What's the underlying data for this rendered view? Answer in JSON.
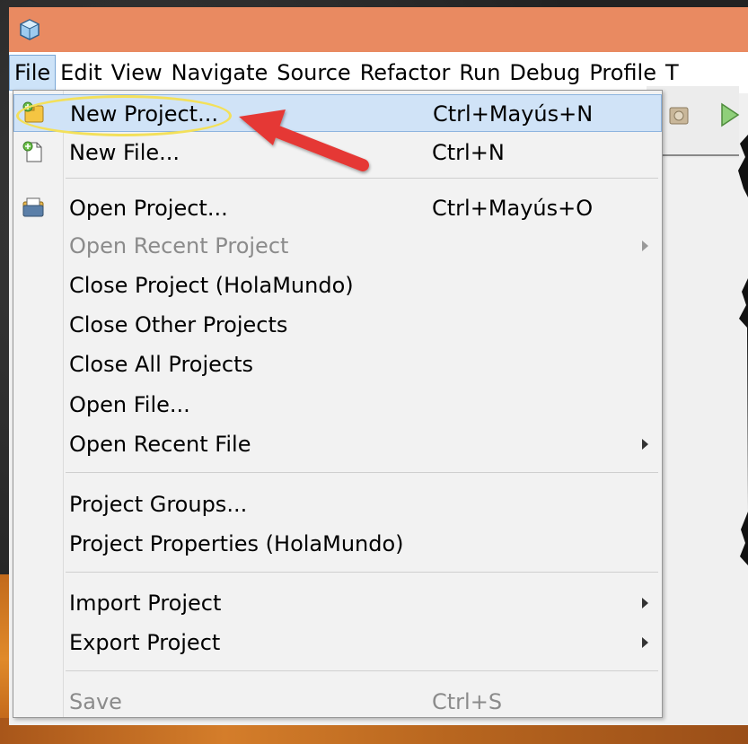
{
  "menubar": {
    "items": [
      {
        "label": "File",
        "active": true
      },
      {
        "label": "Edit"
      },
      {
        "label": "View"
      },
      {
        "label": "Navigate"
      },
      {
        "label": "Source"
      },
      {
        "label": "Refactor"
      },
      {
        "label": "Run"
      },
      {
        "label": "Debug"
      },
      {
        "label": "Profile"
      },
      {
        "label": "T"
      }
    ]
  },
  "file_menu": {
    "new_project": {
      "label": "New Project...",
      "shortcut": "Ctrl+Mayús+N",
      "icon": "new-project-icon"
    },
    "new_file": {
      "label": "New File...",
      "shortcut": "Ctrl+N",
      "icon": "new-file-icon"
    },
    "open_project": {
      "label": "Open Project...",
      "shortcut": "Ctrl+Mayús+O",
      "icon": "open-project-icon"
    },
    "open_recent_project": {
      "label": "Open Recent Project"
    },
    "close_project": {
      "label": "Close Project (HolaMundo)"
    },
    "close_other_projects": {
      "label": "Close Other Projects"
    },
    "close_all_projects": {
      "label": "Close All Projects"
    },
    "open_file": {
      "label": "Open File..."
    },
    "open_recent_file": {
      "label": "Open Recent File"
    },
    "project_groups": {
      "label": "Project Groups..."
    },
    "project_properties": {
      "label": "Project Properties (HolaMundo)"
    },
    "import_project": {
      "label": "Import Project"
    },
    "export_project": {
      "label": "Export Project"
    },
    "save": {
      "label": "Save",
      "shortcut": "Ctrl+S"
    }
  },
  "colors": {
    "titlebar": "#e98a61",
    "highlight": "#d0e3f7",
    "annotation_ring": "#f3e05a",
    "annotation_arrow": "#e53935"
  }
}
